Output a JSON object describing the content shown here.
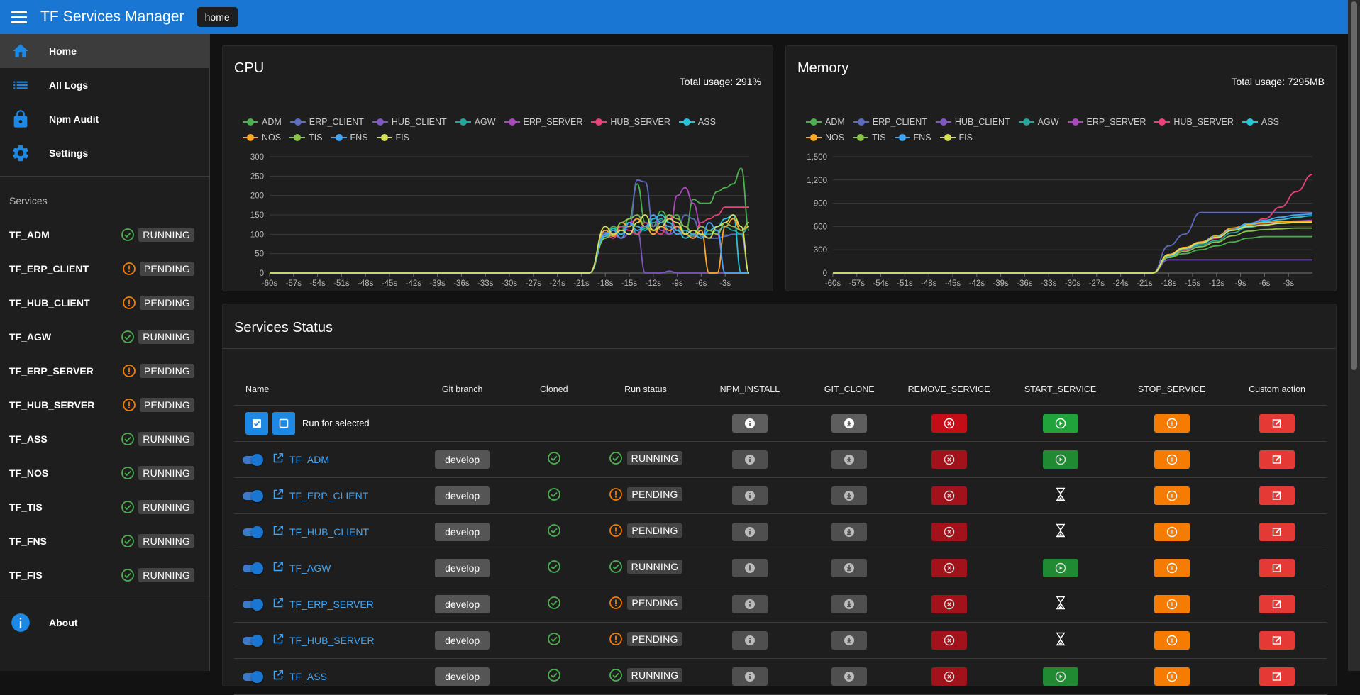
{
  "app": {
    "title": "TF Services Manager",
    "crumb": "home"
  },
  "nav": [
    {
      "label": "Home",
      "icon": "home-icon"
    },
    {
      "label": "All Logs",
      "icon": "list-icon"
    },
    {
      "label": "Npm Audit",
      "icon": "lock-icon"
    },
    {
      "label": "Settings",
      "icon": "gear-icon"
    }
  ],
  "services_heading": "Services",
  "services": [
    {
      "name": "TF_ADM",
      "status": "RUNNING"
    },
    {
      "name": "TF_ERP_CLIENT",
      "status": "PENDING"
    },
    {
      "name": "TF_HUB_CLIENT",
      "status": "PENDING"
    },
    {
      "name": "TF_AGW",
      "status": "RUNNING"
    },
    {
      "name": "TF_ERP_SERVER",
      "status": "PENDING"
    },
    {
      "name": "TF_HUB_SERVER",
      "status": "PENDING"
    },
    {
      "name": "TF_ASS",
      "status": "RUNNING"
    },
    {
      "name": "TF_NOS",
      "status": "RUNNING"
    },
    {
      "name": "TF_TIS",
      "status": "RUNNING"
    },
    {
      "name": "TF_FNS",
      "status": "RUNNING"
    },
    {
      "name": "TF_FIS",
      "status": "RUNNING"
    }
  ],
  "about": "About",
  "colors": {
    "appbar": "#1976d2",
    "running": "#4caf50",
    "pending": "#f57c00"
  },
  "cpu": {
    "title": "CPU",
    "usage": "Total usage: 291%"
  },
  "memory": {
    "title": "Memory",
    "usage": "Total usage: 7295MB"
  },
  "legend": [
    {
      "name": "ADM",
      "color": "#4caf50"
    },
    {
      "name": "ERP_CLIENT",
      "color": "#5c6bc0"
    },
    {
      "name": "HUB_CLIENT",
      "color": "#7e57c2"
    },
    {
      "name": "AGW",
      "color": "#26a69a"
    },
    {
      "name": "ERP_SERVER",
      "color": "#ab47bc"
    },
    {
      "name": "HUB_SERVER",
      "color": "#ec407a"
    },
    {
      "name": "ASS",
      "color": "#26c6da"
    },
    {
      "name": "NOS",
      "color": "#ffa726"
    },
    {
      "name": "TIS",
      "color": "#8bc34a"
    },
    {
      "name": "FNS",
      "color": "#42a5f5"
    },
    {
      "name": "FIS",
      "color": "#d4e157"
    }
  ],
  "chart_data": [
    {
      "type": "line",
      "title": "CPU",
      "xticks": [
        "-60s",
        "-57s",
        "-54s",
        "-51s",
        "-48s",
        "-45s",
        "-42s",
        "-39s",
        "-36s",
        "-33s",
        "-30s",
        "-27s",
        "-24s",
        "-21s",
        "-18s",
        "-15s",
        "-12s",
        "-9s",
        "-6s",
        "-3s"
      ],
      "xlim": [
        -60,
        0
      ],
      "ylim": [
        0,
        300
      ],
      "yticks": [
        "0",
        "50",
        "100",
        "150",
        "200",
        "250",
        "300"
      ],
      "x": [
        -60,
        -20,
        -18,
        -17,
        -16,
        -15,
        -14,
        -13,
        -12,
        -11,
        -10,
        -9,
        -8,
        -7,
        -6,
        -5,
        -4,
        -3,
        -2,
        -1,
        0
      ],
      "series": [
        {
          "name": "ADM",
          "values": [
            0,
            0,
            100,
            120,
            110,
            140,
            230,
            130,
            120,
            160,
            140,
            150,
            100,
            190,
            180,
            180,
            210,
            220,
            230,
            270,
            110
          ]
        },
        {
          "name": "ERP_CLIENT",
          "values": [
            0,
            0,
            105,
            95,
            110,
            120,
            240,
            235,
            120,
            135,
            100,
            110,
            150,
            140,
            95,
            90,
            90,
            95,
            100,
            100,
            0
          ]
        },
        {
          "name": "HUB_CLIENT",
          "values": [
            0,
            0,
            100,
            100,
            90,
            100,
            110,
            0,
            0,
            0,
            5,
            0,
            0,
            0,
            0,
            0,
            0,
            0,
            0,
            0,
            0
          ]
        },
        {
          "name": "AGW",
          "values": [
            0,
            0,
            90,
            110,
            120,
            130,
            100,
            115,
            130,
            140,
            110,
            120,
            100,
            95,
            100,
            100,
            110,
            120,
            110,
            100,
            120
          ]
        },
        {
          "name": "ERP_SERVER",
          "values": [
            0,
            0,
            110,
            100,
            90,
            130,
            140,
            120,
            150,
            110,
            100,
            200,
            220,
            180,
            120,
            110,
            100,
            0,
            0,
            0,
            0
          ]
        },
        {
          "name": "HUB_SERVER",
          "values": [
            0,
            0,
            100,
            90,
            120,
            110,
            100,
            130,
            110,
            100,
            150,
            110,
            100,
            90,
            130,
            140,
            150,
            170,
            170,
            170,
            170
          ]
        },
        {
          "name": "ASS",
          "values": [
            0,
            0,
            95,
            115,
            100,
            130,
            120,
            110,
            140,
            150,
            130,
            110,
            90,
            100,
            90,
            110,
            120,
            140,
            150,
            0,
            0
          ]
        },
        {
          "name": "NOS",
          "values": [
            0,
            0,
            110,
            95,
            130,
            120,
            140,
            120,
            100,
            120,
            110,
            120,
            100,
            90,
            110,
            0,
            0,
            120,
            140,
            110,
            120
          ]
        },
        {
          "name": "TIS",
          "values": [
            0,
            0,
            90,
            100,
            130,
            140,
            150,
            120,
            110,
            130,
            150,
            140,
            120,
            100,
            120,
            110,
            100,
            130,
            120,
            110,
            130
          ]
        },
        {
          "name": "FNS",
          "values": [
            0,
            0,
            100,
            110,
            90,
            130,
            110,
            120,
            150,
            130,
            120,
            100,
            110,
            100,
            90,
            130,
            110,
            0,
            0,
            0,
            0
          ]
        },
        {
          "name": "FIS",
          "values": [
            0,
            0,
            120,
            100,
            110,
            100,
            130,
            150,
            110,
            120,
            140,
            130,
            100,
            110,
            100,
            90,
            120,
            130,
            150,
            120,
            0
          ]
        }
      ]
    },
    {
      "type": "line",
      "title": "Memory",
      "xticks": [
        "-60s",
        "-57s",
        "-54s",
        "-51s",
        "-48s",
        "-45s",
        "-42s",
        "-39s",
        "-36s",
        "-33s",
        "-30s",
        "-27s",
        "-24s",
        "-21s",
        "-18s",
        "-15s",
        "-12s",
        "-9s",
        "-6s",
        "-3s"
      ],
      "xlim": [
        -60,
        0
      ],
      "ylim": [
        0,
        1500
      ],
      "yticks": [
        "0",
        "300",
        "600",
        "900",
        "1,200",
        "1,500"
      ],
      "x": [
        -60,
        -20,
        -18,
        -16,
        -14,
        -12,
        -10,
        -8,
        -6,
        -4,
        -2,
        0
      ],
      "series": [
        {
          "name": "ADM",
          "values": [
            0,
            0,
            200,
            250,
            300,
            350,
            400,
            450,
            470,
            470,
            470,
            470
          ]
        },
        {
          "name": "ERP_CLIENT",
          "values": [
            0,
            0,
            350,
            500,
            780,
            780,
            780,
            780,
            780,
            780,
            780,
            780
          ]
        },
        {
          "name": "HUB_CLIENT",
          "values": [
            0,
            0,
            170,
            170,
            170,
            170,
            170,
            170,
            170,
            170,
            170,
            170
          ]
        },
        {
          "name": "AGW",
          "values": [
            0,
            0,
            220,
            300,
            360,
            420,
            520,
            590,
            620,
            640,
            650,
            650
          ]
        },
        {
          "name": "ERP_SERVER",
          "values": [
            0,
            0,
            230,
            320,
            390,
            470,
            560,
            620,
            640,
            660,
            670,
            680
          ]
        },
        {
          "name": "HUB_SERVER",
          "values": [
            0,
            0,
            200,
            300,
            380,
            450,
            550,
            620,
            700,
            850,
            1050,
            1270
          ]
        },
        {
          "name": "ASS",
          "values": [
            0,
            0,
            210,
            310,
            380,
            460,
            560,
            620,
            660,
            690,
            720,
            740
          ]
        },
        {
          "name": "NOS",
          "values": [
            0,
            0,
            240,
            330,
            400,
            480,
            580,
            630,
            650,
            660,
            660,
            660
          ]
        },
        {
          "name": "TIS",
          "values": [
            0,
            0,
            200,
            280,
            340,
            400,
            480,
            540,
            560,
            570,
            580,
            580
          ]
        },
        {
          "name": "FNS",
          "values": [
            0,
            0,
            220,
            310,
            390,
            470,
            560,
            640,
            680,
            720,
            750,
            760
          ]
        },
        {
          "name": "FIS",
          "values": [
            0,
            0,
            230,
            320,
            390,
            460,
            550,
            600,
            620,
            640,
            650,
            650
          ]
        }
      ]
    }
  ],
  "status": {
    "title": "Services Status",
    "headers": [
      "Name",
      "Git branch",
      "Cloned",
      "Run status",
      "NPM_INSTALL",
      "GIT_CLONE",
      "REMOVE_SERVICE",
      "START_SERVICE",
      "STOP_SERVICE",
      "Custom action"
    ],
    "run_selected": "Run for selected",
    "rows": [
      {
        "name": "TF_ADM",
        "branch": "develop",
        "status": "RUNNING",
        "start": "play"
      },
      {
        "name": "TF_ERP_CLIENT",
        "branch": "develop",
        "status": "PENDING",
        "start": "hourglass"
      },
      {
        "name": "TF_HUB_CLIENT",
        "branch": "develop",
        "status": "PENDING",
        "start": "hourglass"
      },
      {
        "name": "TF_AGW",
        "branch": "develop",
        "status": "RUNNING",
        "start": "play"
      },
      {
        "name": "TF_ERP_SERVER",
        "branch": "develop",
        "status": "PENDING",
        "start": "hourglass"
      },
      {
        "name": "TF_HUB_SERVER",
        "branch": "develop",
        "status": "PENDING",
        "start": "hourglass"
      },
      {
        "name": "TF_ASS",
        "branch": "develop",
        "status": "RUNNING",
        "start": "play"
      }
    ]
  }
}
